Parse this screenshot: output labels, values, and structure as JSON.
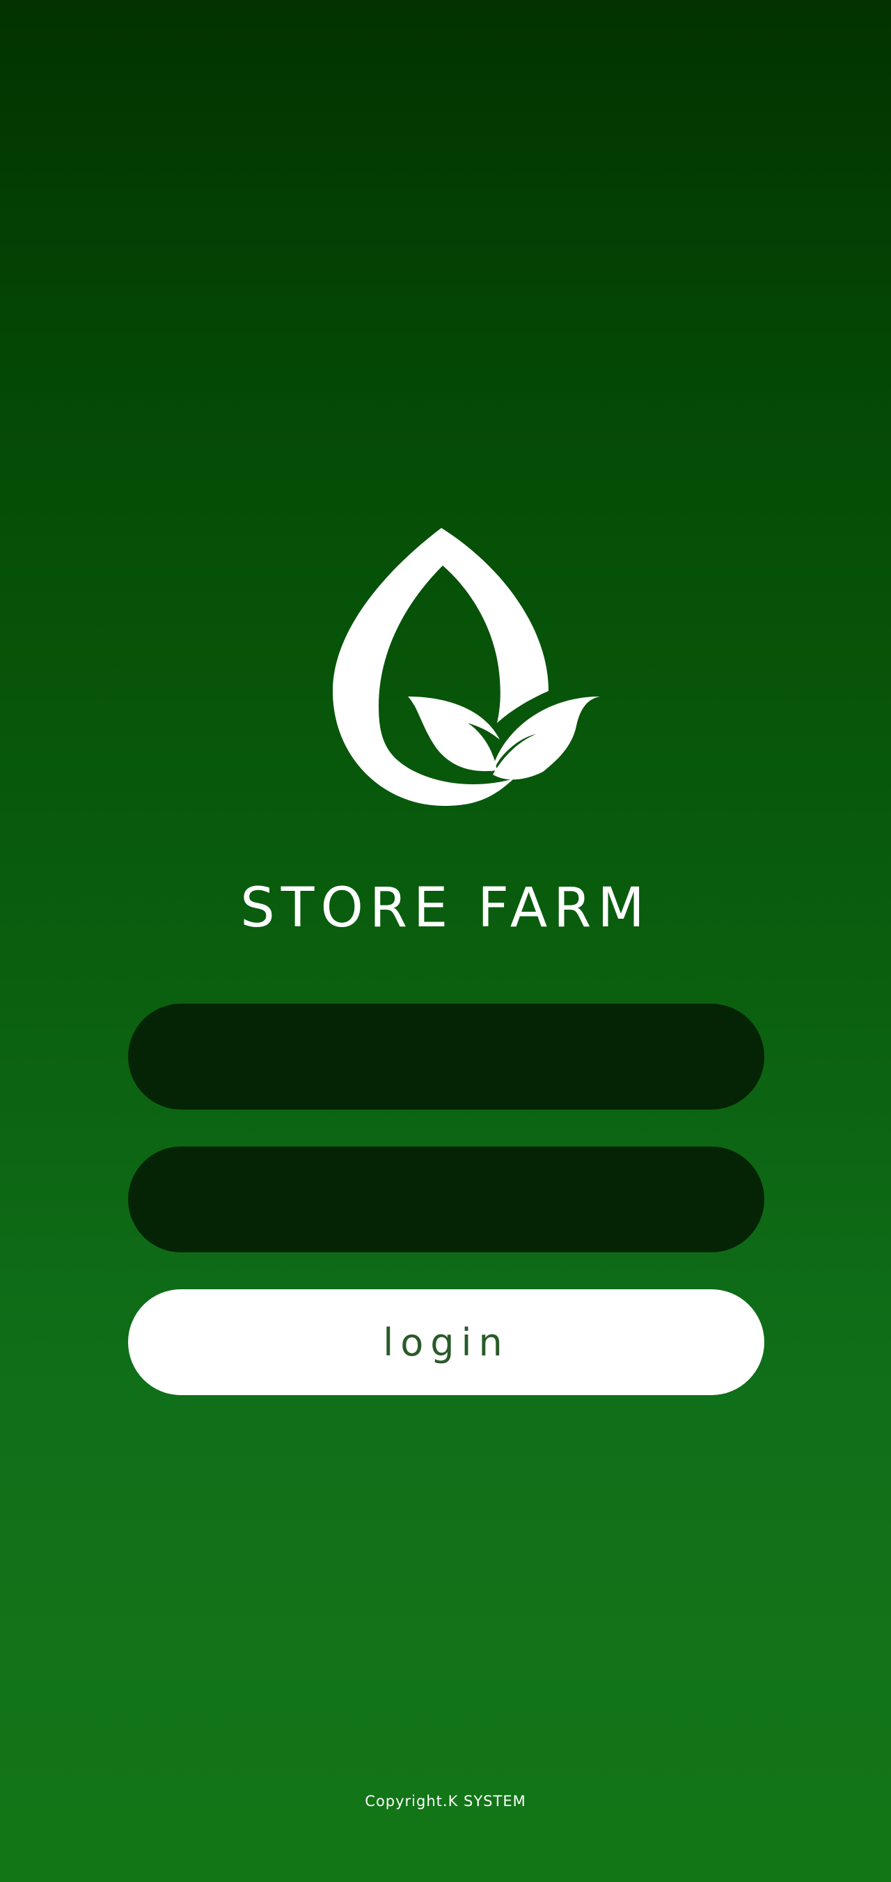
{
  "app": {
    "title": "STORE FARM",
    "logo_icon": "leaf-drop-logo"
  },
  "form": {
    "id_field": {
      "value": "",
      "placeholder": ""
    },
    "password_field": {
      "value": "",
      "placeholder": ""
    },
    "login_label": "login"
  },
  "footer": {
    "copyright": "Copyright.K SYSTEM"
  },
  "colors": {
    "background_top": "#023300",
    "background_bottom": "#137616",
    "field_fill": "#052405",
    "button_fill": "#ffffff",
    "button_text": "#2a5a2a"
  }
}
